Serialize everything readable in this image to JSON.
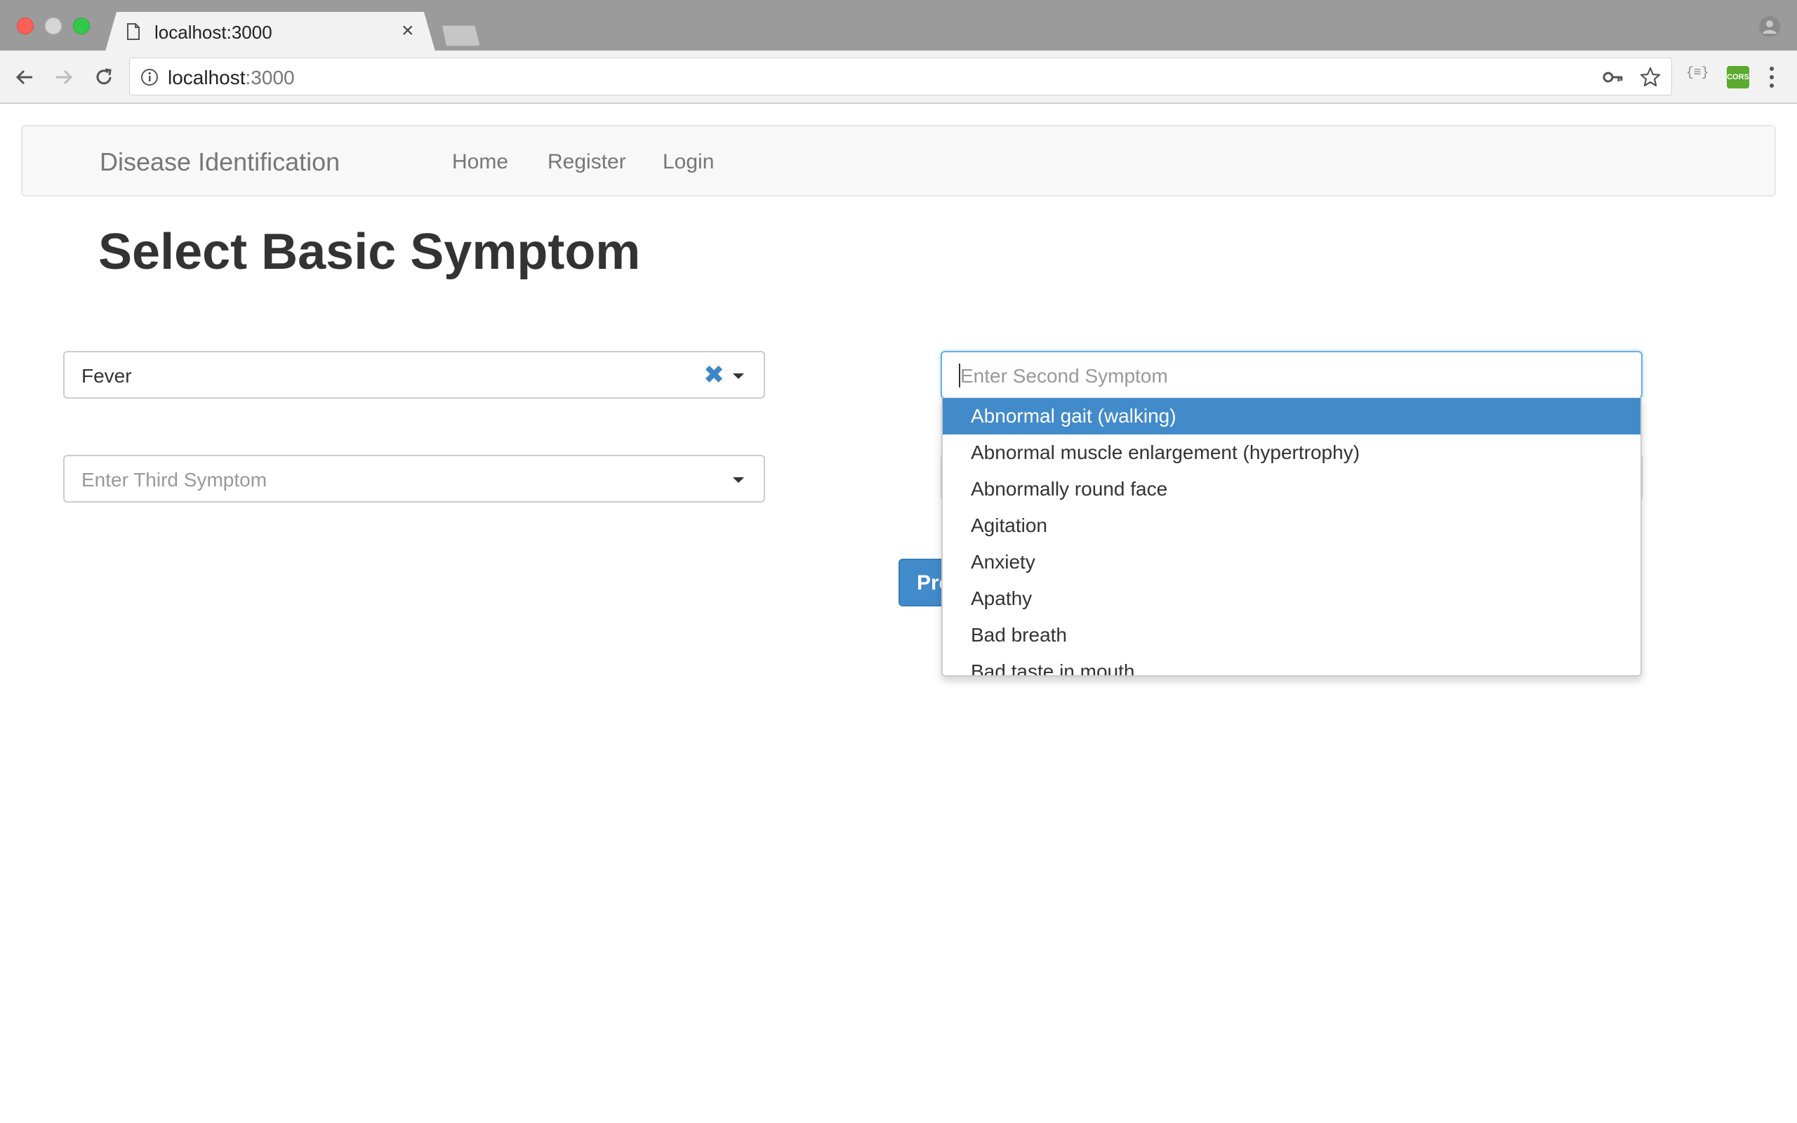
{
  "browser": {
    "tab_title": "localhost:3000",
    "tab_close": "×",
    "url_host": "localhost",
    "url_port": ":3000",
    "ext_json_label": "{≡}",
    "ext_cors_label": "CORS"
  },
  "navbar": {
    "brand": "Disease Identification",
    "links": [
      "Home",
      "Register",
      "Login"
    ]
  },
  "page": {
    "title": "Select Basic Symptom"
  },
  "symptom1": {
    "value": "Fever",
    "clear_glyph": "✖"
  },
  "symptom2": {
    "placeholder": "Enter Second Symptom",
    "options": [
      "Abnormal gait (walking)",
      "Abnormal muscle enlargement (hypertrophy)",
      "Abnormally round face",
      "Agitation",
      "Anxiety",
      "Apathy",
      "Bad breath",
      "Bad taste in mouth"
    ],
    "highlighted_index": 0
  },
  "symptom3": {
    "placeholder": "Enter Third Symptom"
  },
  "predict_button": {
    "label": "Predict"
  },
  "colors": {
    "accent": "#428bca",
    "clear_icon": "#3c87c8"
  }
}
